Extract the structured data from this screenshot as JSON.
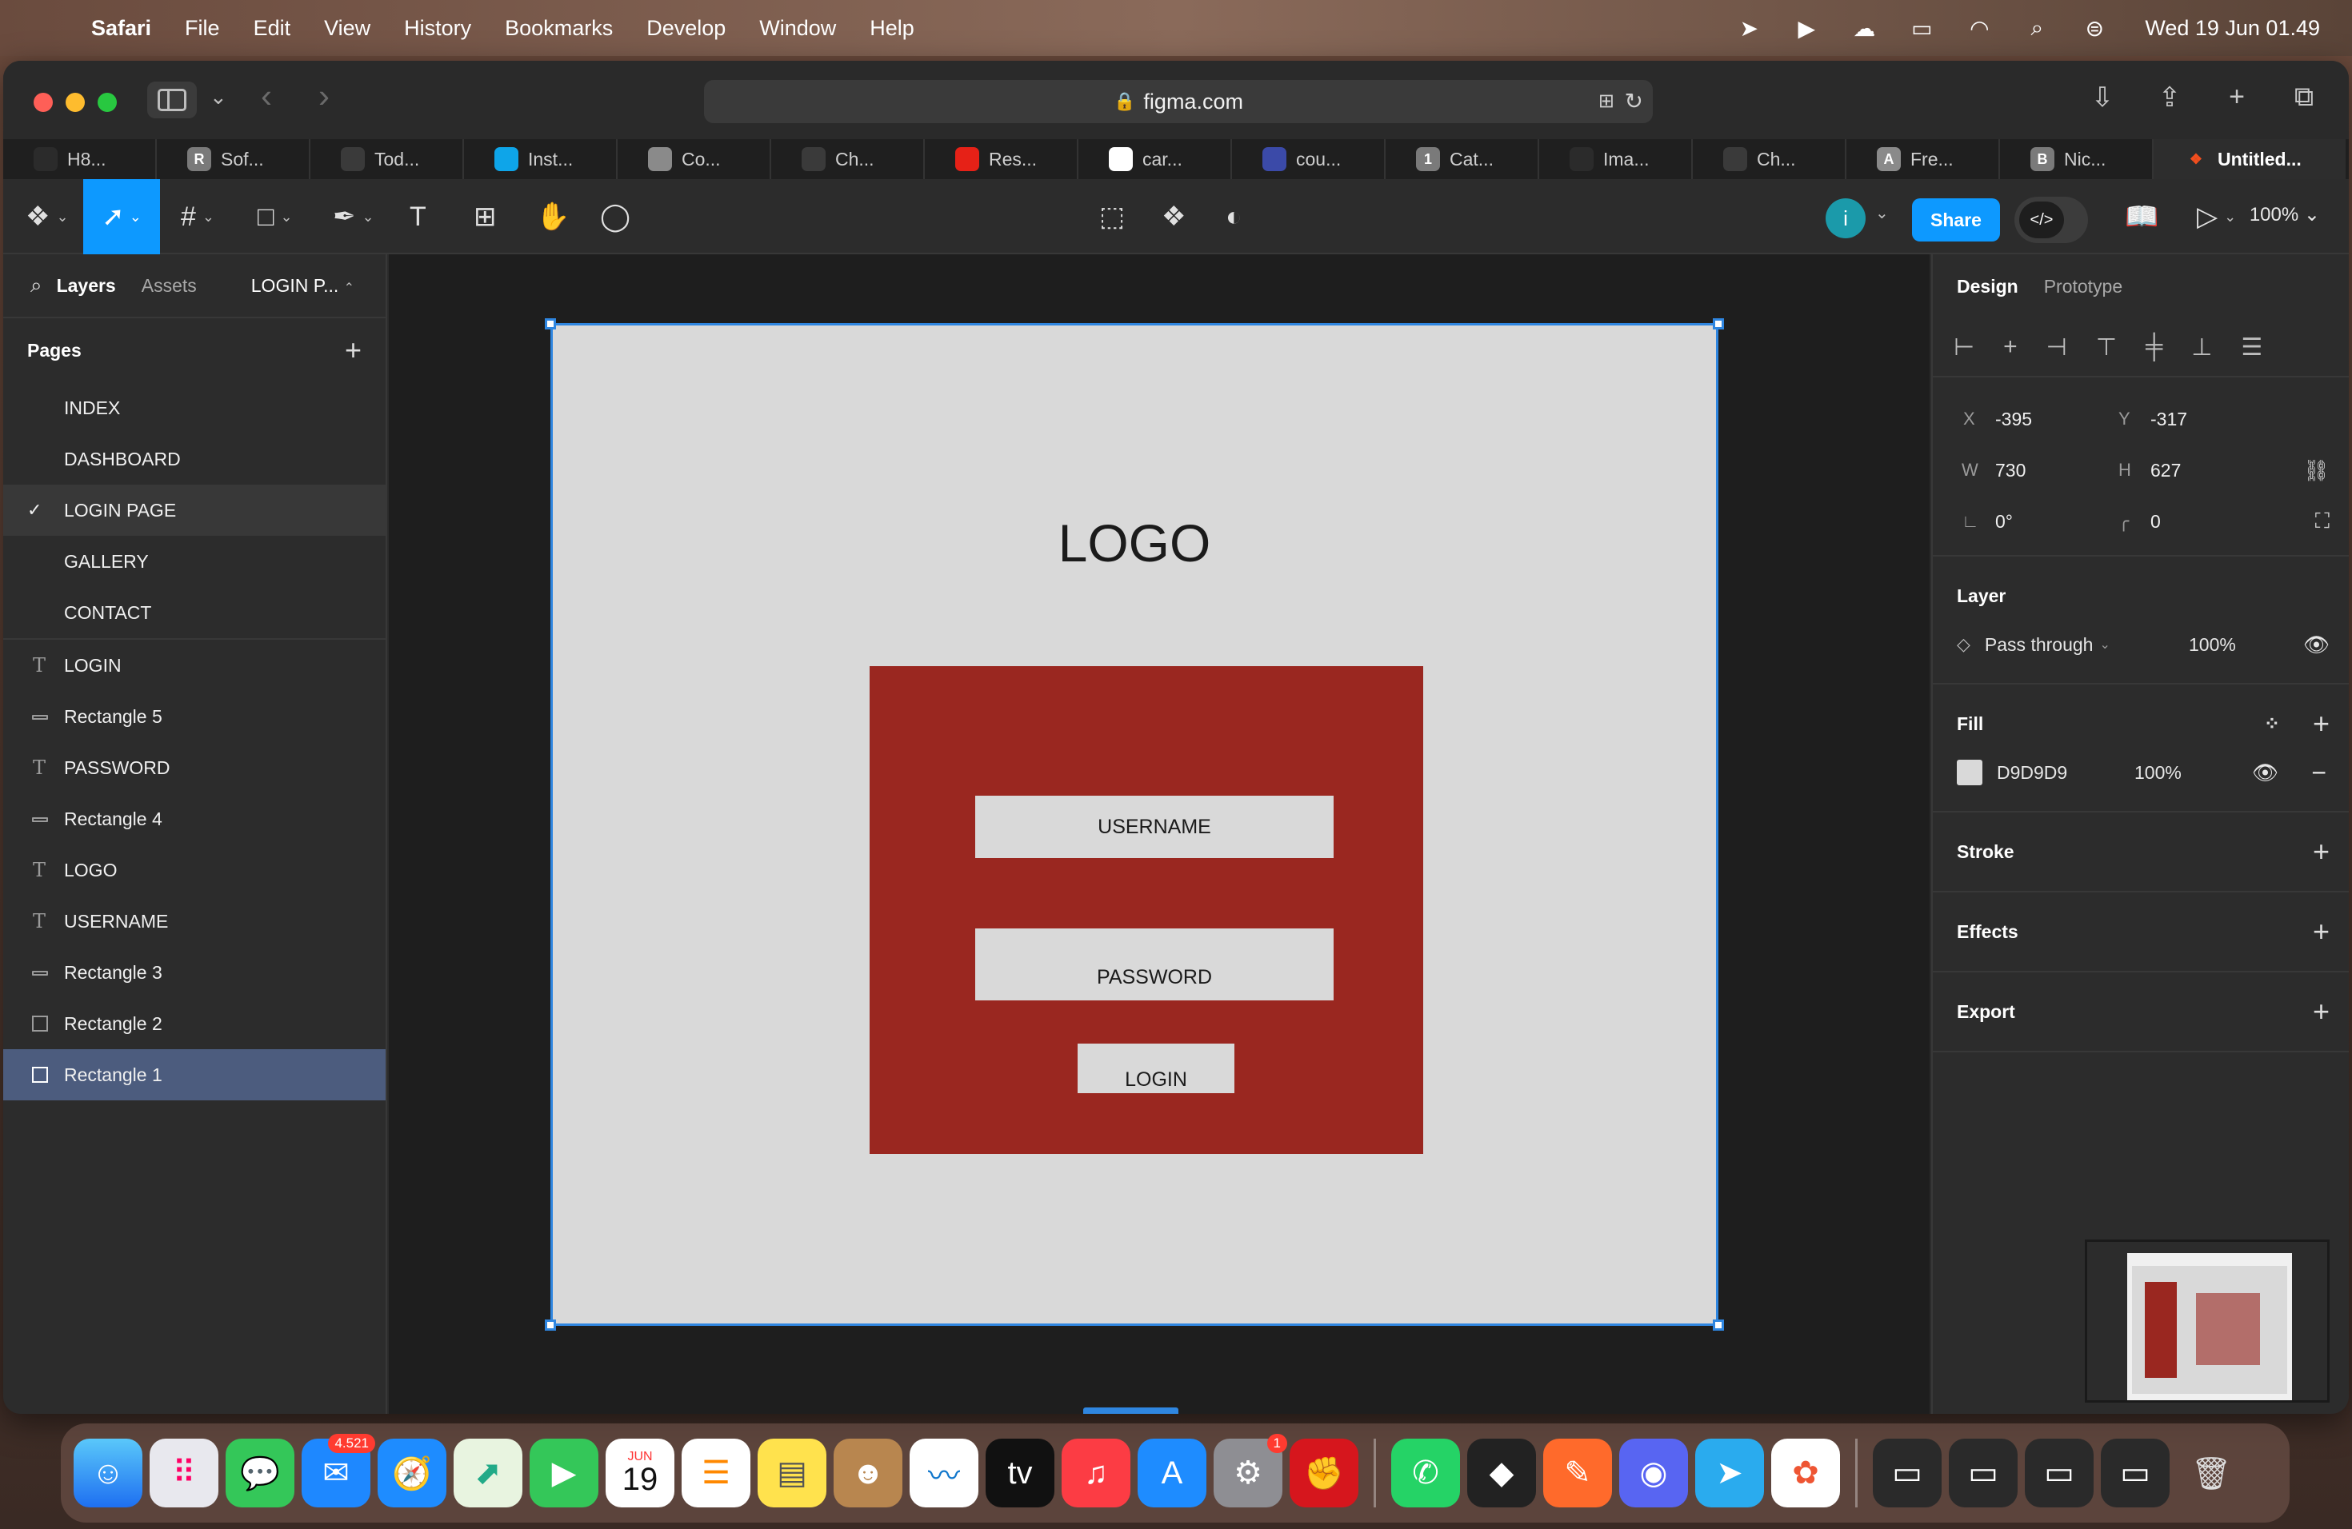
{
  "menubar": {
    "app_name": "Safari",
    "items": [
      "File",
      "Edit",
      "View",
      "History",
      "Bookmarks",
      "Develop",
      "Window",
      "Help"
    ],
    "clock": "Wed 19 Jun  01.49"
  },
  "browser": {
    "url": "figma.com",
    "tabs": [
      {
        "label": "H8...",
        "icon": "github-icon",
        "color": "#2b2b2b"
      },
      {
        "label": "Sof...",
        "icon": "R",
        "color": "#7a7a7a"
      },
      {
        "label": "Tod...",
        "icon": "chatgpt-icon",
        "color": "#3a3a3a"
      },
      {
        "label": "Inst...",
        "icon": "tailwind-icon",
        "color": "#0ea5e9"
      },
      {
        "label": "Co...",
        "icon": "cloud-icon",
        "color": "#8a8a8a"
      },
      {
        "label": "Ch...",
        "icon": "chatgpt-icon",
        "color": "#3a3a3a"
      },
      {
        "label": "Res...",
        "icon": "youtube-icon",
        "color": "#e62117"
      },
      {
        "label": "car...",
        "icon": "google-icon",
        "color": "#ffffff"
      },
      {
        "label": "cou...",
        "icon": "cloud-icon",
        "color": "#3b4aa8"
      },
      {
        "label": "Cat...",
        "icon": "1",
        "color": "#7a7a7a"
      },
      {
        "label": "Ima...",
        "icon": "github-icon",
        "color": "#2b2b2b"
      },
      {
        "label": "Ch...",
        "icon": "chatgpt-icon",
        "color": "#3a3a3a"
      },
      {
        "label": "Fre...",
        "icon": "A",
        "color": "#8a8a8a"
      },
      {
        "label": "Nic...",
        "icon": "B",
        "color": "#7a7a7a"
      }
    ],
    "active_tab": "Untitled..."
  },
  "figma": {
    "share_label": "Share",
    "avatar_initial": "i",
    "zoom": "100%",
    "left_tabs": {
      "layers": "Layers",
      "assets": "Assets",
      "current_page": "LOGIN P..."
    },
    "pages_title": "Pages",
    "pages": [
      "INDEX",
      "DASHBOARD",
      "LOGIN PAGE",
      "GALLERY",
      "CONTACT"
    ],
    "current_page_index": 2,
    "layers": [
      {
        "name": "LOGIN",
        "type": "text"
      },
      {
        "name": "Rectangle 5",
        "type": "rect-line"
      },
      {
        "name": "PASSWORD",
        "type": "text"
      },
      {
        "name": "Rectangle 4",
        "type": "rect-line"
      },
      {
        "name": "LOGO",
        "type": "text"
      },
      {
        "name": "USERNAME",
        "type": "text"
      },
      {
        "name": "Rectangle 3",
        "type": "rect-line"
      },
      {
        "name": "Rectangle 2",
        "type": "rect-box"
      },
      {
        "name": "Rectangle 1",
        "type": "rect-box",
        "selected": true
      }
    ],
    "canvas": {
      "logo": "LOGO",
      "username": "USERNAME",
      "password": "PASSWORD",
      "login": "LOGIN",
      "dimensions": "730 × 627",
      "frame_color": "#d9d9d9",
      "card_color": "#9a2720"
    },
    "right": {
      "design_tab": "Design",
      "prototype_tab": "Prototype",
      "x_label": "X",
      "x": "-395",
      "y_label": "Y",
      "y": "-317",
      "w_label": "W",
      "w": "730",
      "h_label": "H",
      "h": "627",
      "rotation": "0°",
      "radius": "0",
      "layer_title": "Layer",
      "blend": "Pass through",
      "opacity": "100%",
      "fill_title": "Fill",
      "fill_hex": "D9D9D9",
      "fill_opacity": "100%",
      "stroke_title": "Stroke",
      "effects_title": "Effects",
      "export_title": "Export"
    }
  },
  "dock": {
    "mail_badge": "4.521",
    "settings_badge": "1",
    "calendar_month": "JUN",
    "calendar_day": "19"
  }
}
